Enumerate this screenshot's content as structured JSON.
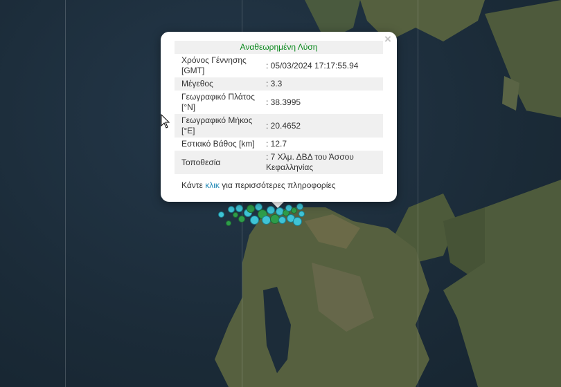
{
  "popup": {
    "title": "Αναθεωρημένη Λύση",
    "close_symbol": "×",
    "rows": [
      {
        "label": "Χρόνος Γέννησης [GMT]",
        "value": ": 05/03/2024 17:17:55.94"
      },
      {
        "label": "Μέγεθος",
        "value": ": 3.3"
      },
      {
        "label": "Γεωγραφικό Πλάτος [°N]",
        "value": ": 38.3995"
      },
      {
        "label": "Γεωγραφικό Μήκος [°E]",
        "value": ": 20.4652"
      },
      {
        "label": "Εστιακό Βάθος [km]",
        "value": ": 12.7"
      },
      {
        "label": "Τοποθεσία",
        "value": ": 7 Χλμ. ΔΒΔ του Άσσου Κεφαλληνίας"
      }
    ],
    "footer_prefix": "Κάντε ",
    "footer_link": "κλικ",
    "footer_suffix": " για περισσότερες πληροφορίες"
  },
  "map": {
    "marker_colors": {
      "recent": "#3fc4d6",
      "revised": "#2e9d4a"
    }
  }
}
